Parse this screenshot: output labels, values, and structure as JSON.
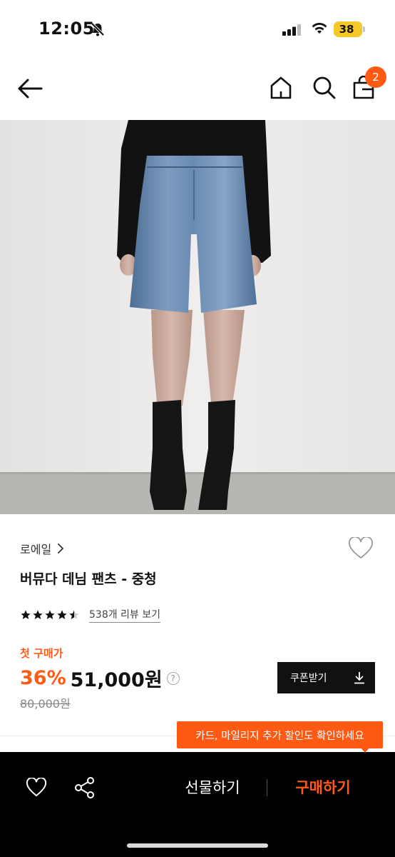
{
  "status": {
    "time": "12:05",
    "battery": "38"
  },
  "header": {
    "cart_count": "2"
  },
  "product": {
    "brand": "로에일",
    "title": "버뮤다 데님 팬츠 - 중청",
    "review_link": "538개 리뷰 보기",
    "rating": 4.5,
    "first_purchase_label": "첫 구매가",
    "discount": "36%",
    "price": "51,000원",
    "original_price": "80,000원",
    "coupon_button": "쿠폰받기"
  },
  "tooltip": {
    "text": "카드, 마일리지 추가 할인도 확인하세요"
  },
  "bottom": {
    "gift_label": "선물하기",
    "buy_label": "구매하기"
  },
  "colors": {
    "accent": "#ff5a14",
    "dark": "#111111"
  }
}
